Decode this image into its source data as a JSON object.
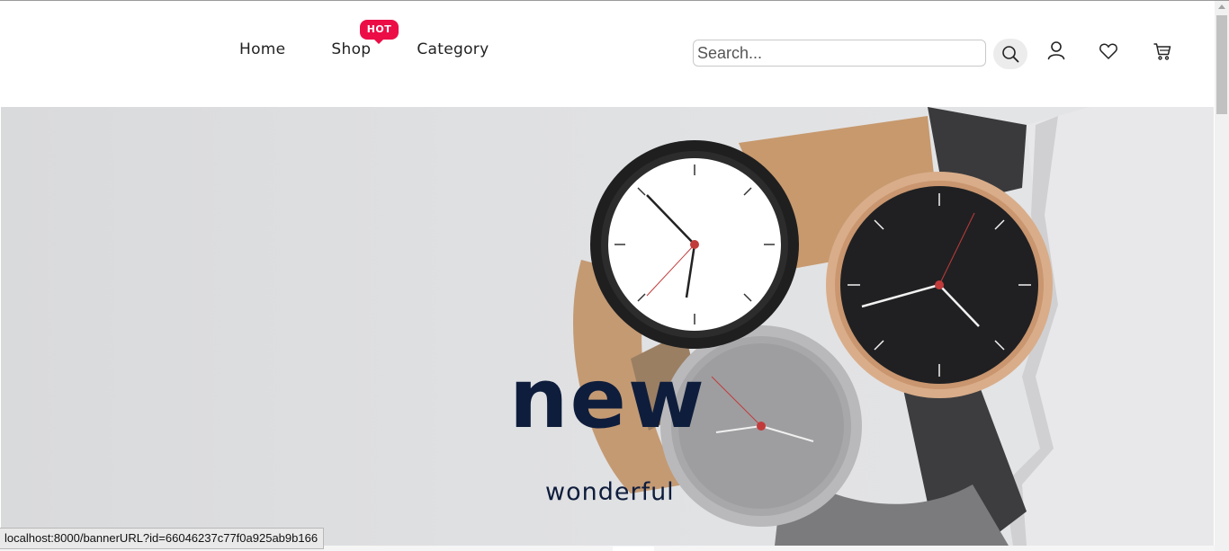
{
  "nav": {
    "items": [
      {
        "label": "Home"
      },
      {
        "label": "Shop",
        "badge": "HOT"
      },
      {
        "label": "Category"
      }
    ]
  },
  "search": {
    "placeholder": "Search...",
    "value": ""
  },
  "header_icons": [
    "search-icon",
    "user-icon",
    "heart-icon",
    "cart-icon"
  ],
  "banner": {
    "headline": "new",
    "subtitle": "wonderful"
  },
  "status_bar": {
    "url": "localhost:8000/bannerURL?id=66046237c77f0a925ab9b166"
  },
  "colors": {
    "accent": "#ec0d47",
    "headline": "#0e1d3c",
    "banner_bg": "#dfe0e2"
  }
}
